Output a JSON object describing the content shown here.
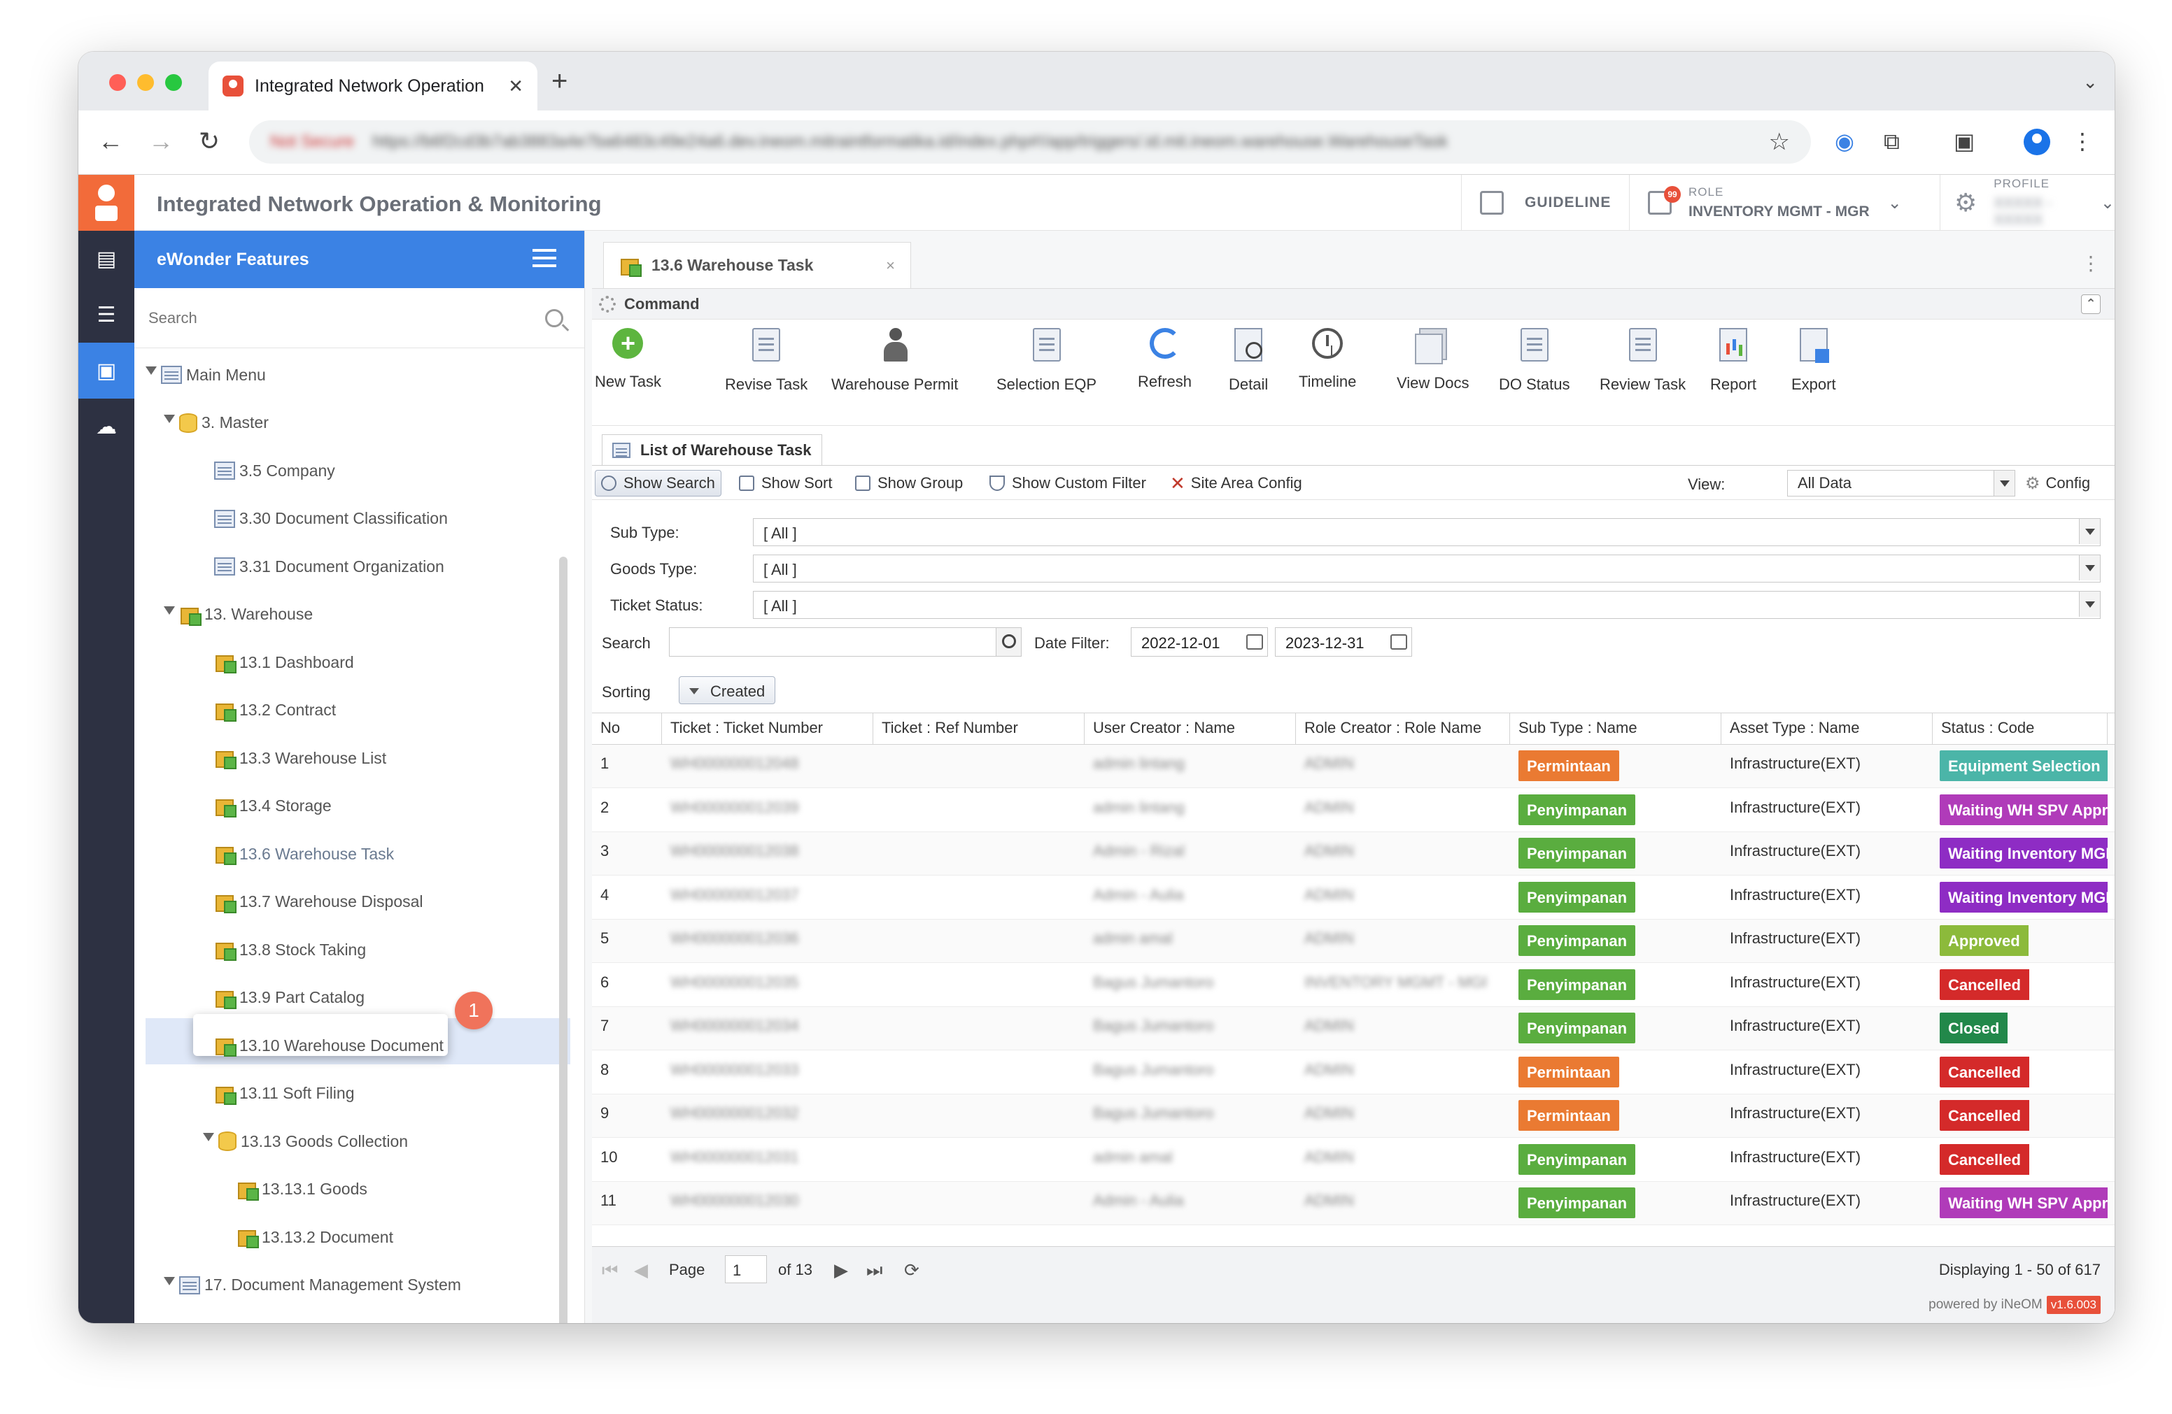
{
  "browser": {
    "tab_title": "Integrated Network Operation",
    "tab_close": "✕",
    "new_tab": "+",
    "tab_menu": "⌄",
    "url_prefix": "Not Secure",
    "url": "https://b6f2cd3b7ab3883a4e7ba6483c49e24a6.dev.ineom.mitraintformatika.id/index.php#!/app/triggers/.id.mit.ineom.warehouse.WarehouseTask",
    "back": "←",
    "forward": "→",
    "reload": "↻",
    "star": "☆",
    "ext_badge": "1"
  },
  "app": {
    "title": "Integrated Network Operation & Monitoring",
    "guideline": "GUIDELINE",
    "role_label": "ROLE",
    "role_value": "INVENTORY MGMT - MGR",
    "role_badge": "99",
    "profile_label": "PROFILE",
    "profile_value": "XXXXX - XXXXX",
    "chevron": "⌄"
  },
  "sidebar": {
    "header": "eWonder Features",
    "search_placeholder": "Search",
    "items": [
      {
        "label": "Main Menu",
        "icon": "doc",
        "depth": 0,
        "arrow": true
      },
      {
        "label": "3. Master",
        "icon": "db",
        "depth": 1,
        "arrow": true
      },
      {
        "label": "3.5 Company",
        "icon": "doc",
        "depth": 2,
        "arrow": false
      },
      {
        "label": "3.30 Document Classification",
        "icon": "doc",
        "depth": 2,
        "arrow": false
      },
      {
        "label": "3.31 Document Organization",
        "icon": "doc",
        "depth": 2,
        "arrow": false
      },
      {
        "label": "13. Warehouse",
        "icon": "box",
        "depth": 1,
        "arrow": true
      },
      {
        "label": "13.1 Dashboard",
        "icon": "box",
        "depth": 2,
        "arrow": false
      },
      {
        "label": "13.2 Contract",
        "icon": "box",
        "depth": 2,
        "arrow": false
      },
      {
        "label": "13.3 Warehouse List",
        "icon": "box",
        "depth": 2,
        "arrow": false
      },
      {
        "label": "13.4 Storage",
        "icon": "box",
        "depth": 2,
        "arrow": false
      },
      {
        "label": "13.6 Warehouse Task",
        "icon": "box",
        "depth": 2,
        "arrow": false
      },
      {
        "label": "13.7 Warehouse Disposal",
        "icon": "box",
        "depth": 2,
        "arrow": false
      },
      {
        "label": "13.8 Stock Taking",
        "icon": "box",
        "depth": 2,
        "arrow": false
      },
      {
        "label": "13.9 Part Catalog",
        "icon": "box",
        "depth": 2,
        "arrow": false
      },
      {
        "label": "13.10 Warehouse Document",
        "icon": "box",
        "depth": 2,
        "arrow": false
      },
      {
        "label": "13.11 Soft Filing",
        "icon": "box",
        "depth": 2,
        "arrow": false
      },
      {
        "label": "13.13 Goods Collection",
        "icon": "db",
        "depth": 2,
        "arrow": true
      },
      {
        "label": "13.13.1 Goods",
        "icon": "box",
        "depth": 3,
        "arrow": false
      },
      {
        "label": "13.13.2 Document",
        "icon": "box",
        "depth": 3,
        "arrow": false
      },
      {
        "label": "17. Document Management System",
        "icon": "doc",
        "depth": 1,
        "arrow": true
      }
    ],
    "selected_index": 10,
    "step_badge": "1"
  },
  "content": {
    "tab_title": "13.6 Warehouse Task",
    "tab_close": "×",
    "command_title": "Command",
    "toolbar": [
      {
        "label": "New Task",
        "icon": "plus"
      },
      {
        "label": "Revise Task",
        "icon": "doc"
      },
      {
        "label": "Warehouse Permit",
        "icon": "person"
      },
      {
        "label": "Selection EQP",
        "icon": "doc"
      },
      {
        "label": "Refresh",
        "icon": "refresh"
      },
      {
        "label": "Detail",
        "icon": "mag"
      },
      {
        "label": "Timeline",
        "icon": "clock"
      },
      {
        "label": "View Docs",
        "icon": "files"
      },
      {
        "label": "DO Status",
        "icon": "doc"
      },
      {
        "label": "Review Task",
        "icon": "doc"
      },
      {
        "label": "Report",
        "icon": "chart"
      },
      {
        "label": "Export",
        "icon": "export"
      }
    ],
    "list_title": "List of Warehouse Task",
    "list_buttons": [
      "Show Search",
      "Show Sort",
      "Show Group",
      "Show Custom Filter",
      "Site Area Config"
    ],
    "view_label": "View:",
    "view_value": "All Data",
    "config_label": "Config",
    "filters": [
      {
        "label": "Sub Type:",
        "value": "[ All ]"
      },
      {
        "label": "Goods Type:",
        "value": "[ All ]"
      },
      {
        "label": "Ticket Status:",
        "value": "[ All ]"
      }
    ],
    "search_label": "Search",
    "search_value": "",
    "date_filter_label": "Date Filter:",
    "date_from": "2022-12-01",
    "date_to": "2023-12-31",
    "sorting_label": "Sorting",
    "sorting_value": "Created",
    "columns": [
      "No",
      "Ticket : Ticket Number",
      "Ticket : Ref Number",
      "User Creator : Name",
      "Role Creator : Role Name",
      "Sub Type : Name",
      "Asset Type : Name",
      "Status : Code"
    ],
    "rows": [
      {
        "no": "1",
        "ticket": "WH000000012048",
        "ref": "",
        "user": "admin lintang",
        "role": "ADMIN",
        "subtype": "Permintaan",
        "asset": "Infrastructure(EXT)",
        "status": "Equipment Selection"
      },
      {
        "no": "2",
        "ticket": "WH000000012039",
        "ref": "",
        "user": "admin lintang",
        "role": "ADMIN",
        "subtype": "Penyimpanan",
        "asset": "Infrastructure(EXT)",
        "status": "Waiting WH SPV Approval"
      },
      {
        "no": "3",
        "ticket": "WH000000012038",
        "ref": "",
        "user": "Admin - Rizal",
        "role": "ADMIN",
        "subtype": "Penyimpanan",
        "asset": "Infrastructure(EXT)",
        "status": "Waiting Inventory MGR"
      },
      {
        "no": "4",
        "ticket": "WH000000012037",
        "ref": "",
        "user": "Admin - Aulia",
        "role": "ADMIN",
        "subtype": "Penyimpanan",
        "asset": "Infrastructure(EXT)",
        "status": "Waiting Inventory MGR"
      },
      {
        "no": "5",
        "ticket": "WH000000012036",
        "ref": "",
        "user": "admin amal",
        "role": "ADMIN",
        "subtype": "Penyimpanan",
        "asset": "Infrastructure(EXT)",
        "status": "Approved"
      },
      {
        "no": "6",
        "ticket": "WH000000012035",
        "ref": "",
        "user": "Bagus Jumantoro",
        "role": "INVENTORY MGMT - MGR",
        "subtype": "Penyimpanan",
        "asset": "Infrastructure(EXT)",
        "status": "Cancelled"
      },
      {
        "no": "7",
        "ticket": "WH000000012034",
        "ref": "",
        "user": "Bagus Jumantoro",
        "role": "ADMIN",
        "subtype": "Penyimpanan",
        "asset": "Infrastructure(EXT)",
        "status": "Closed"
      },
      {
        "no": "8",
        "ticket": "WH000000012033",
        "ref": "",
        "user": "Bagus Jumantoro",
        "role": "ADMIN",
        "subtype": "Permintaan",
        "asset": "Infrastructure(EXT)",
        "status": "Cancelled"
      },
      {
        "no": "9",
        "ticket": "WH000000012032",
        "ref": "",
        "user": "Bagus Jumantoro",
        "role": "ADMIN",
        "subtype": "Permintaan",
        "asset": "Infrastructure(EXT)",
        "status": "Cancelled"
      },
      {
        "no": "10",
        "ticket": "WH000000012031",
        "ref": "",
        "user": "admin amal",
        "role": "ADMIN",
        "subtype": "Penyimpanan",
        "asset": "Infrastructure(EXT)",
        "status": "Cancelled"
      },
      {
        "no": "11",
        "ticket": "WH000000012030",
        "ref": "",
        "user": "Admin - Aulia",
        "role": "ADMIN",
        "subtype": "Penyimpanan",
        "asset": "Infrastructure(EXT)",
        "status": "Waiting WH SPV Approval"
      }
    ],
    "subtype_colors": {
      "Permintaan": "#ea7a32",
      "Penyimpanan": "#5aad3f"
    },
    "status_colors": {
      "Equipment Selection": "#4bb5a8",
      "Waiting WH SPV Approval": "#b03bb9",
      "Waiting Inventory MGR": "#8e2cc4",
      "Approved": "#8cba3b",
      "Cancelled": "#d42a2a",
      "Closed": "#22884a"
    },
    "pager": {
      "page_label": "Page",
      "page_value": "1",
      "of_label": "of 13",
      "display": "Displaying 1 - 50 of 617",
      "powered": "powered by iNeOM",
      "version": "v1.6.003"
    }
  }
}
